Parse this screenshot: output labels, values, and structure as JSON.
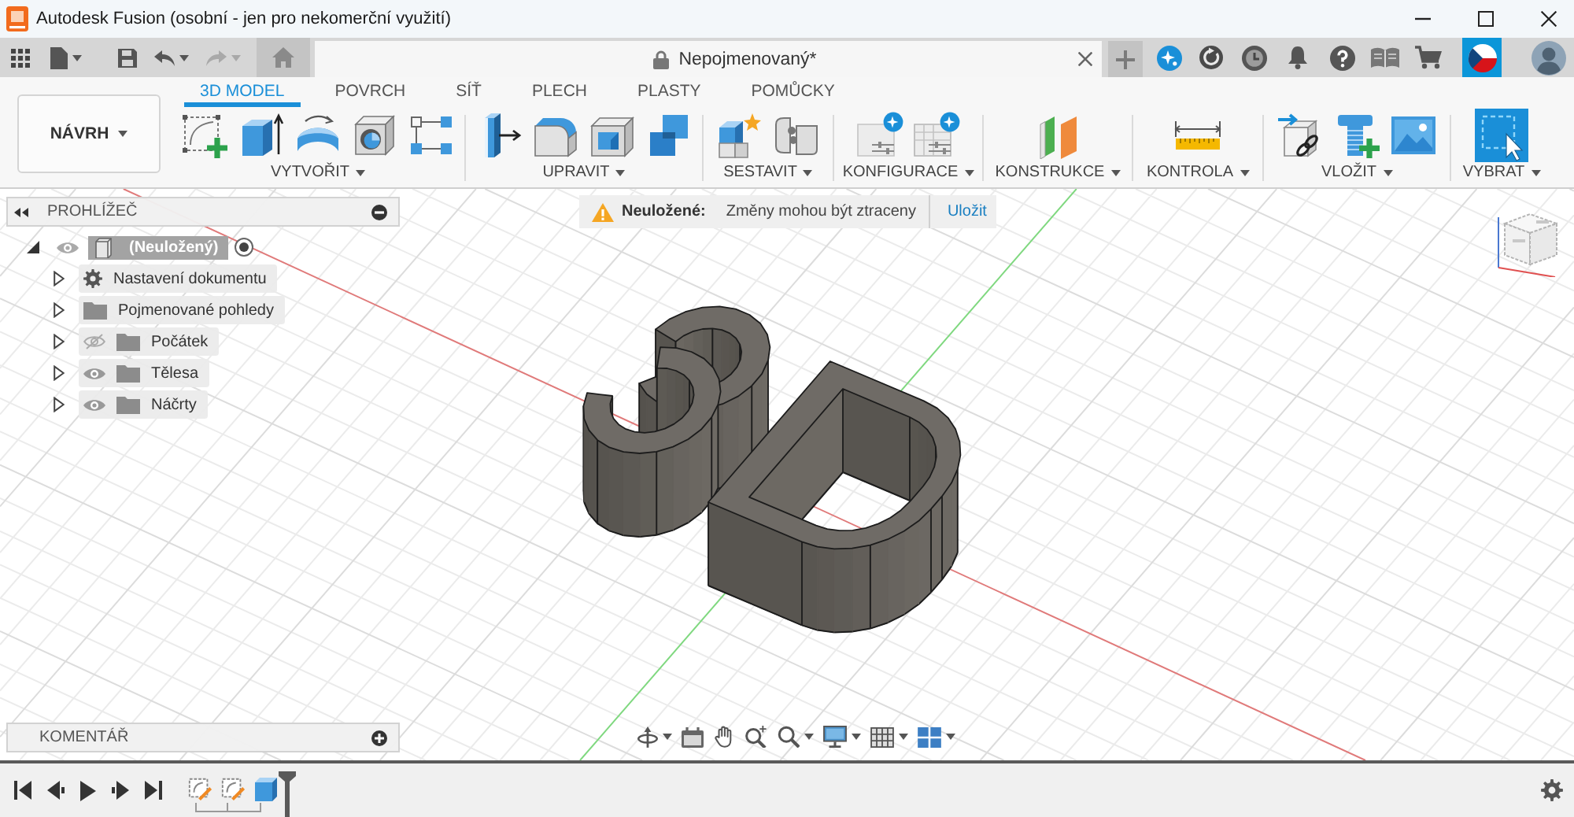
{
  "window": {
    "title": "Autodesk Fusion (osobní - jen pro nekomerční využití)"
  },
  "history": {
    "undo": {
      "disabled": false
    },
    "redo": {
      "disabled": true
    }
  },
  "document_tab": {
    "title": "Nepojmenovaný*"
  },
  "toolbar": {
    "workspace": "NÁVRH",
    "tabs": [
      {
        "label": "3D MODEL",
        "selected": true
      },
      {
        "label": "POVRCH",
        "selected": false
      },
      {
        "label": "SÍŤ",
        "selected": false
      },
      {
        "label": "PLECH",
        "selected": false
      },
      {
        "label": "PLASTY",
        "selected": false
      },
      {
        "label": "POMŮCKY",
        "selected": false
      }
    ],
    "groups": [
      {
        "kind": "create",
        "label": "VYTVOŘIT"
      },
      {
        "kind": "modify",
        "label": "UPRAVIT"
      },
      {
        "kind": "assemble",
        "label": "SESTAVIT"
      },
      {
        "kind": "configure",
        "label": "KONFIGURACE"
      },
      {
        "kind": "construct",
        "label": "KONSTRUKCE"
      },
      {
        "kind": "inspect",
        "label": "KONTROLA"
      },
      {
        "kind": "insert",
        "label": "VLOŽIT"
      },
      {
        "kind": "select",
        "label": "VYBRAT"
      }
    ]
  },
  "browser": {
    "title": "PROHLÍŽEČ",
    "root": {
      "label": "(Neuložený)",
      "expanded": true,
      "visible": true,
      "active": true,
      "children": [
        {
          "kind": "settings",
          "label": "Nastavení dokumentu",
          "expanded": false
        },
        {
          "kind": "views",
          "label": "Pojmenované pohledy",
          "expanded": false
        },
        {
          "kind": "folder",
          "label": "Počátek",
          "expanded": false,
          "visible": false
        },
        {
          "kind": "folder",
          "label": "Tělesa",
          "expanded": false,
          "visible": true
        },
        {
          "kind": "folder",
          "label": "Náčrty",
          "expanded": false,
          "visible": true
        }
      ]
    }
  },
  "notification": {
    "label": "Neuložené:",
    "message": "Změny mohou být ztraceny",
    "action": "Uložit"
  },
  "comments": {
    "title": "KOMENTÁŘ"
  },
  "timeline": {
    "features": [
      {
        "kind": "sketch"
      },
      {
        "kind": "sketch"
      },
      {
        "kind": "extrude"
      }
    ]
  }
}
